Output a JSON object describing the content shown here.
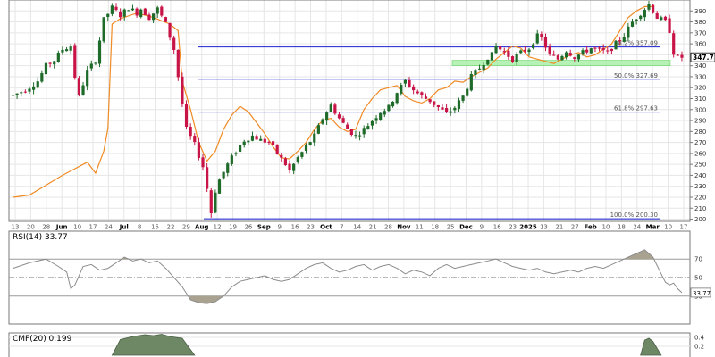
{
  "colors": {
    "up": "#1e6b2a",
    "down": "#c81446",
    "overlay": "#f08a24",
    "fib": "#1a1fd4",
    "grid": "#e6e6e6",
    "frame": "#7a7a7a",
    "zone": "#aaf0aa",
    "rsi_line": "#8c8c8c",
    "rsi_fill": "#aaa290",
    "cmf_fill": "#6e8866",
    "price_badge": "#000000"
  },
  "chart_data": [
    {
      "type": "candlestick",
      "panel": "price",
      "ylim": [
        198,
        400
      ],
      "price_axis_ticks": [
        "390",
        "380",
        "370",
        "360",
        "350",
        "340",
        "330",
        "320",
        "310",
        "300",
        "290",
        "280",
        "270",
        "260",
        "250",
        "240",
        "230",
        "220",
        "210",
        "200"
      ],
      "last_price_label": "347.71",
      "x_ticks": [
        "13",
        "20",
        "28",
        "Jun",
        "10",
        "17",
        "24",
        "Jul",
        "8",
        "15",
        "22",
        "29",
        "Aug",
        "12",
        "19",
        "26",
        "Sep",
        "9",
        "16",
        "23",
        "Oct",
        "7",
        "14",
        "21",
        "28",
        "Nov",
        "11",
        "18",
        "25",
        "Dec",
        "9",
        "16",
        "23",
        "2025",
        "13",
        "21",
        "27",
        "Feb",
        "10",
        "18",
        "24",
        "Mar",
        "10",
        "17"
      ],
      "x_tick_bold": [
        "Jun",
        "Jul",
        "Aug",
        "Sep",
        "Oct",
        "Nov",
        "Dec",
        "2025",
        "Feb",
        "Mar"
      ],
      "support_zone": [
        340,
        345
      ],
      "fib_levels": [
        {
          "label": "38.2% 357.09",
          "value": 357.09
        },
        {
          "label": "50.0% 327.69",
          "value": 327.69
        },
        {
          "label": "61.8% 297.63",
          "value": 297.63
        },
        {
          "label": "100.0% 200.30",
          "value": 200.3
        }
      ],
      "waypoints": [
        [
          0,
          313
        ],
        [
          3,
          318
        ],
        [
          6,
          326
        ],
        [
          8,
          340
        ],
        [
          10,
          345
        ],
        [
          12,
          355
        ],
        [
          14,
          358
        ],
        [
          15,
          330
        ],
        [
          16,
          312
        ],
        [
          18,
          335
        ],
        [
          20,
          345
        ],
        [
          22,
          382
        ],
        [
          24,
          393
        ],
        [
          26,
          386
        ],
        [
          28,
          393
        ],
        [
          30,
          388
        ],
        [
          31,
          392
        ],
        [
          33,
          384
        ],
        [
          35,
          392
        ],
        [
          37,
          378
        ],
        [
          39,
          355
        ],
        [
          41,
          305
        ],
        [
          42,
          282
        ],
        [
          44,
          268
        ],
        [
          46,
          248
        ],
        [
          47,
          228
        ],
        [
          48,
          206
        ],
        [
          49,
          226
        ],
        [
          50,
          236
        ],
        [
          52,
          250
        ],
        [
          54,
          262
        ],
        [
          56,
          272
        ],
        [
          58,
          276
        ],
        [
          60,
          272
        ],
        [
          62,
          270
        ],
        [
          64,
          260
        ],
        [
          66,
          250
        ],
        [
          67,
          244
        ],
        [
          69,
          256
        ],
        [
          71,
          266
        ],
        [
          73,
          276
        ],
        [
          75,
          292
        ],
        [
          77,
          304
        ],
        [
          79,
          292
        ],
        [
          81,
          282
        ],
        [
          83,
          276
        ],
        [
          85,
          282
        ],
        [
          87,
          290
        ],
        [
          89,
          298
        ],
        [
          91,
          302
        ],
        [
          93,
          316
        ],
        [
          95,
          326
        ],
        [
          97,
          318
        ],
        [
          99,
          312
        ],
        [
          101,
          308
        ],
        [
          103,
          302
        ],
        [
          105,
          296
        ],
        [
          107,
          302
        ],
        [
          109,
          312
        ],
        [
          111,
          330
        ],
        [
          113,
          338
        ],
        [
          115,
          348
        ],
        [
          116,
          350
        ],
        [
          117,
          358
        ],
        [
          119,
          352
        ],
        [
          121,
          346
        ],
        [
          123,
          352
        ],
        [
          125,
          356
        ],
        [
          126,
          362
        ],
        [
          127,
          367
        ],
        [
          128,
          365
        ],
        [
          130,
          350
        ],
        [
          132,
          346
        ],
        [
          134,
          354
        ],
        [
          136,
          348
        ],
        [
          138,
          352
        ],
        [
          140,
          356
        ],
        [
          142,
          354
        ],
        [
          144,
          352
        ],
        [
          146,
          360
        ],
        [
          148,
          368
        ],
        [
          150,
          380
        ],
        [
          152,
          388
        ],
        [
          153,
          392
        ],
        [
          154,
          396
        ],
        [
          155,
          390
        ],
        [
          156,
          384
        ],
        [
          158,
          380
        ],
        [
          159,
          372
        ],
        [
          160,
          352
        ],
        [
          161,
          347.71
        ]
      ],
      "overlay_line": [
        [
          0,
          220
        ],
        [
          4,
          222
        ],
        [
          8,
          231
        ],
        [
          12,
          240
        ],
        [
          14,
          244
        ],
        [
          18,
          252
        ],
        [
          20,
          242
        ],
        [
          22,
          262
        ],
        [
          23,
          283
        ],
        [
          24,
          378
        ],
        [
          26,
          383
        ],
        [
          30,
          388
        ],
        [
          34,
          384
        ],
        [
          38,
          378
        ],
        [
          40,
          372
        ],
        [
          41,
          326
        ],
        [
          43,
          300
        ],
        [
          45,
          270
        ],
        [
          47,
          253
        ],
        [
          49,
          262
        ],
        [
          51,
          282
        ],
        [
          53,
          295
        ],
        [
          55,
          303
        ],
        [
          57,
          298
        ],
        [
          59,
          288
        ],
        [
          61,
          278
        ],
        [
          63,
          266
        ],
        [
          65,
          256
        ],
        [
          67,
          255
        ],
        [
          69,
          262
        ],
        [
          71,
          270
        ],
        [
          73,
          282
        ],
        [
          75,
          290
        ],
        [
          77,
          292
        ],
        [
          79,
          284
        ],
        [
          81,
          280
        ],
        [
          83,
          282
        ],
        [
          85,
          300
        ],
        [
          87,
          310
        ],
        [
          89,
          318
        ],
        [
          91,
          320
        ],
        [
          93,
          322
        ],
        [
          95,
          312
        ],
        [
          97,
          308
        ],
        [
          99,
          306
        ],
        [
          101,
          310
        ],
        [
          103,
          318
        ],
        [
          105,
          320
        ],
        [
          107,
          326
        ],
        [
          109,
          325
        ],
        [
          111,
          330
        ],
        [
          113,
          334
        ],
        [
          115,
          338
        ],
        [
          117,
          346
        ],
        [
          119,
          352
        ],
        [
          121,
          358
        ],
        [
          123,
          356
        ],
        [
          125,
          348
        ],
        [
          127,
          346
        ],
        [
          129,
          344
        ],
        [
          131,
          342
        ],
        [
          133,
          346
        ],
        [
          135,
          350
        ],
        [
          137,
          352
        ],
        [
          139,
          348
        ],
        [
          141,
          350
        ],
        [
          143,
          355
        ],
        [
          145,
          360
        ],
        [
          147,
          372
        ],
        [
          149,
          384
        ],
        [
          151,
          390
        ],
        [
          153,
          394
        ],
        [
          155,
          394
        ]
      ]
    },
    {
      "type": "line",
      "panel": "indicator",
      "title": "RSI(14) 33.77",
      "ylim": [
        0,
        100
      ],
      "levels": [
        70,
        50,
        30
      ],
      "tick_labels": [
        "70",
        "50",
        "30"
      ],
      "last_value_label": "33.77",
      "waypoints": [
        [
          0,
          60
        ],
        [
          4,
          66
        ],
        [
          8,
          70
        ],
        [
          11,
          62
        ],
        [
          13,
          56
        ],
        [
          14,
          38
        ],
        [
          15,
          42
        ],
        [
          17,
          62
        ],
        [
          19,
          64
        ],
        [
          21,
          58
        ],
        [
          23,
          60
        ],
        [
          25,
          66
        ],
        [
          27,
          72
        ],
        [
          29,
          68
        ],
        [
          31,
          70
        ],
        [
          33,
          66
        ],
        [
          35,
          68
        ],
        [
          37,
          60
        ],
        [
          39,
          50
        ],
        [
          41,
          40
        ],
        [
          43,
          26
        ],
        [
          45,
          23
        ],
        [
          47,
          22
        ],
        [
          49,
          24
        ],
        [
          51,
          30
        ],
        [
          53,
          40
        ],
        [
          55,
          46
        ],
        [
          57,
          48
        ],
        [
          59,
          50
        ],
        [
          61,
          52
        ],
        [
          63,
          48
        ],
        [
          65,
          46
        ],
        [
          67,
          48
        ],
        [
          69,
          54
        ],
        [
          71,
          60
        ],
        [
          73,
          64
        ],
        [
          75,
          66
        ],
        [
          77,
          60
        ],
        [
          79,
          56
        ],
        [
          81,
          58
        ],
        [
          83,
          62
        ],
        [
          85,
          64
        ],
        [
          87,
          58
        ],
        [
          89,
          62
        ],
        [
          91,
          64
        ],
        [
          93,
          60
        ],
        [
          95,
          54
        ],
        [
          97,
          58
        ],
        [
          99,
          56
        ],
        [
          101,
          52
        ],
        [
          103,
          60
        ],
        [
          105,
          64
        ],
        [
          107,
          60
        ],
        [
          109,
          62
        ],
        [
          111,
          64
        ],
        [
          113,
          66
        ],
        [
          115,
          68
        ],
        [
          117,
          70
        ],
        [
          119,
          66
        ],
        [
          121,
          62
        ],
        [
          123,
          60
        ],
        [
          125,
          58
        ],
        [
          127,
          60
        ],
        [
          129,
          56
        ],
        [
          131,
          54
        ],
        [
          133,
          56
        ],
        [
          135,
          58
        ],
        [
          137,
          56
        ],
        [
          139,
          60
        ],
        [
          141,
          62
        ],
        [
          143,
          60
        ],
        [
          145,
          64
        ],
        [
          147,
          68
        ],
        [
          149,
          72
        ],
        [
          151,
          76
        ],
        [
          153,
          80
        ],
        [
          155,
          72
        ],
        [
          157,
          54
        ],
        [
          158,
          45
        ],
        [
          159,
          42
        ],
        [
          160,
          44
        ],
        [
          161,
          38
        ],
        [
          162,
          33.77
        ]
      ]
    },
    {
      "type": "area",
      "panel": "indicator",
      "title": "CMF(20) 0.199",
      "ylim": [
        -0.3,
        0.5
      ],
      "tick_labels": [
        "0.4",
        "0.2"
      ],
      "humps": [
        {
          "start": 24,
          "end": 44,
          "points": [
            [
              24,
              0
            ],
            [
              26,
              0.35
            ],
            [
              29,
              0.42
            ],
            [
              32,
              0.46
            ],
            [
              34,
              0.44
            ],
            [
              36,
              0.47
            ],
            [
              38,
              0.42
            ],
            [
              41,
              0.38
            ],
            [
              44,
              0
            ]
          ]
        },
        {
          "start": 152,
          "end": 157,
          "points": [
            [
              152,
              0
            ],
            [
              153,
              0.34
            ],
            [
              154,
              0.38
            ],
            [
              155,
              0.31
            ],
            [
              157,
              0
            ]
          ]
        }
      ]
    }
  ]
}
